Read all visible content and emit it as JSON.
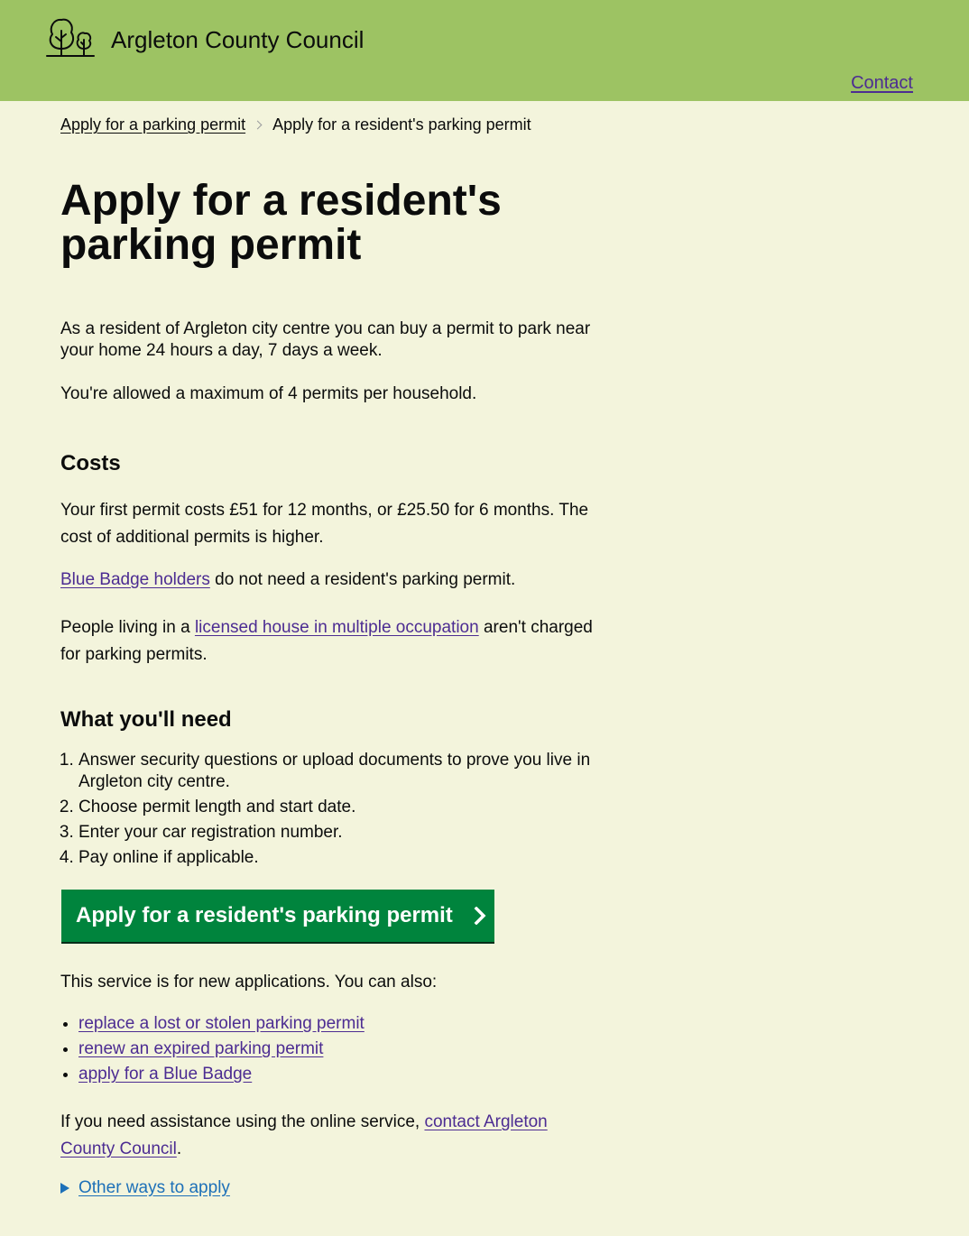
{
  "header": {
    "site_name": "Argleton County Council",
    "logo_icon": "trees-icon",
    "contact_label": "Contact"
  },
  "breadcrumbs": {
    "items": [
      "Apply for a parking permit"
    ],
    "current": "Apply for a resident's parking permit"
  },
  "main": {
    "title": "Apply for a resident's parking permit",
    "intro": "As a resident of Argleton city centre you can buy a permit to park near your home 24 hours a day, 7 days a week.",
    "max_permits": "You're allowed a maximum of 4 permits per household.",
    "costs": {
      "heading": "Costs",
      "first_permit": "Your first permit costs £51 for 12 months, or £25.50 for 6 months. The cost of additional permits is higher.",
      "blue_badge_link": "Blue Badge holders",
      "blue_badge_rest": " do not need a resident's parking permit.",
      "hmo_prefix": "People living in a ",
      "hmo_link": "licensed house in multiple occupation",
      "hmo_suffix": " aren't charged for parking permits."
    },
    "need": {
      "heading": "What you'll need",
      "steps": [
        "Answer security questions or upload documents to prove you live in Argleton city centre.",
        "Choose permit length and start date.",
        "Enter your car registration number.",
        "Pay online if applicable."
      ]
    },
    "start_button": "Apply for a resident's parking permit",
    "also_intro": "This service is for new applications. You can also:",
    "also_links": [
      "replace a lost or stolen parking permit",
      "renew an expired parking permit",
      "apply for a Blue Badge"
    ],
    "assist_prefix": "If you need assistance using the online service, ",
    "assist_link": "contact Argleton County Council",
    "assist_suffix": ".",
    "other_ways": "Other ways to apply"
  },
  "colors": {
    "header_bg": "#9dc363",
    "page_bg": "#f3f4dc",
    "button_green": "#00843d",
    "link_purple": "#4c2c92",
    "details_blue": "#1d70b8"
  }
}
